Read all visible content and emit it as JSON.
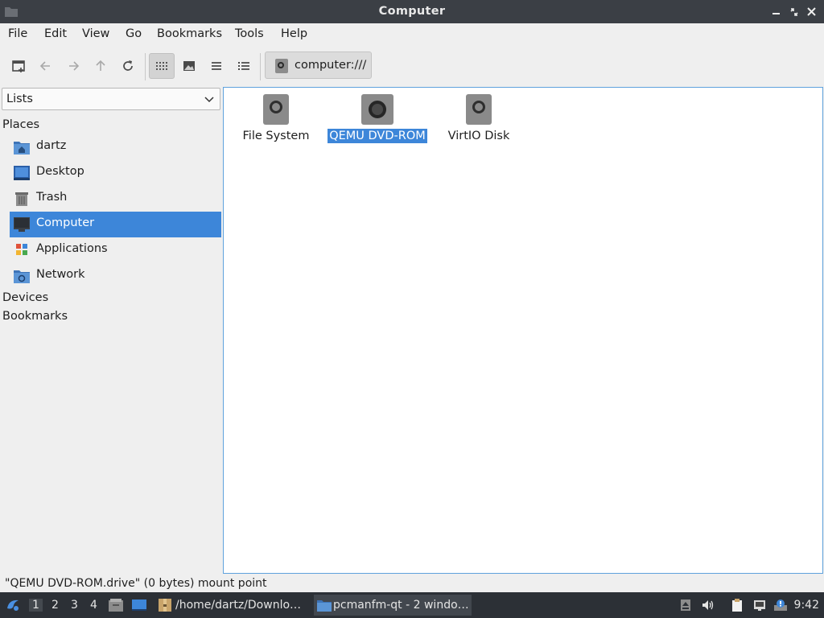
{
  "window": {
    "title": "Computer",
    "icon": "folder-icon",
    "buttons": [
      "minimize",
      "maximize",
      "close"
    ]
  },
  "menu": [
    "File",
    "Edit",
    "View",
    "Go",
    "Bookmarks",
    "Tools",
    "Help"
  ],
  "toolbar": {
    "buttons": [
      "new-window-icon",
      "back-arrow-icon",
      "forward-arrow-icon",
      "up-arrow-icon",
      "reload-icon",
      "icon-view-icon",
      "thumbnail-view-icon",
      "compact-view-icon",
      "detailed-list-view-icon"
    ],
    "active_view": "icon-view"
  },
  "path": {
    "text": "computer:///",
    "icon": "drive-icon"
  },
  "sidebar": {
    "selector": "Lists",
    "sections": {
      "places": "Places",
      "devices": "Devices",
      "bookmarks": "Bookmarks"
    },
    "places": [
      {
        "label": "dartz",
        "icon": "home-folder-icon"
      },
      {
        "label": "Desktop",
        "icon": "desktop-icon"
      },
      {
        "label": "Trash",
        "icon": "trash-icon"
      },
      {
        "label": "Computer",
        "icon": "computer-icon",
        "selected": true
      },
      {
        "label": "Applications",
        "icon": "applications-icon"
      },
      {
        "label": "Network",
        "icon": "network-folder-icon"
      }
    ]
  },
  "content": {
    "items": [
      {
        "label": "File System",
        "icon": "drive-icon"
      },
      {
        "label": "QEMU DVD-ROM",
        "icon": "optical-drive-icon",
        "selected": true
      },
      {
        "label": "VirtIO Disk",
        "icon": "drive-icon"
      }
    ]
  },
  "status": "\"QEMU DVD-ROM.drive\" (0 bytes) mount point",
  "taskbar": {
    "workspaces": [
      "1",
      "2",
      "3",
      "4"
    ],
    "tasks": [
      {
        "label": "/home/dartz/Downlo…",
        "icon": "archive-icon"
      },
      {
        "label": "pcmanfm-qt - 2 windo…",
        "icon": "folder-icon",
        "active": true
      }
    ],
    "clock": "9:42"
  },
  "colors": {
    "accent": "#3d86d9",
    "titlebar": "#3b3f45",
    "taskbar": "#2c3036"
  }
}
